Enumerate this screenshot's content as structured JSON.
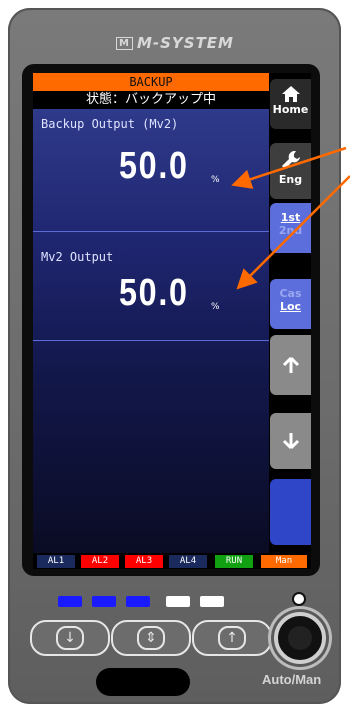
{
  "brand": {
    "mark": "M",
    "name": "M-SYSTEM"
  },
  "header": {
    "mode": "BACKUP",
    "status": "状態：バックアップ中"
  },
  "values": [
    {
      "label": "Backup Output (Mv2)",
      "value": "50.0",
      "unit": "%"
    },
    {
      "label": "Mv2 Output",
      "value": "50.0",
      "unit": "%"
    }
  ],
  "side_buttons": {
    "home": "Home",
    "eng": "Eng",
    "mode1_top": "1st",
    "mode1_bottom": "2nd",
    "mode2_top": "Cas",
    "mode2_bottom": "Loc"
  },
  "alarms": [
    {
      "label": "AL1",
      "color": "#1b2a5c"
    },
    {
      "label": "AL2",
      "color": "#ff0000"
    },
    {
      "label": "AL3",
      "color": "#ff0000"
    },
    {
      "label": "AL4",
      "color": "#1b2a5c"
    },
    {
      "label": "RUN",
      "color": "#11a011"
    },
    {
      "label": "Man",
      "color": "#ff6a00"
    }
  ],
  "leds": [
    "#1a1aff",
    "#1a1aff",
    "#1a1aff",
    "#ffffff",
    "#ffffff"
  ],
  "auto_man": "Auto/Man",
  "colors": {
    "accent_orange": "#ff6a00",
    "panel_blue": "#2e3a8a",
    "button_blue": "#5b6edb",
    "arrow": "#ff6a00"
  }
}
